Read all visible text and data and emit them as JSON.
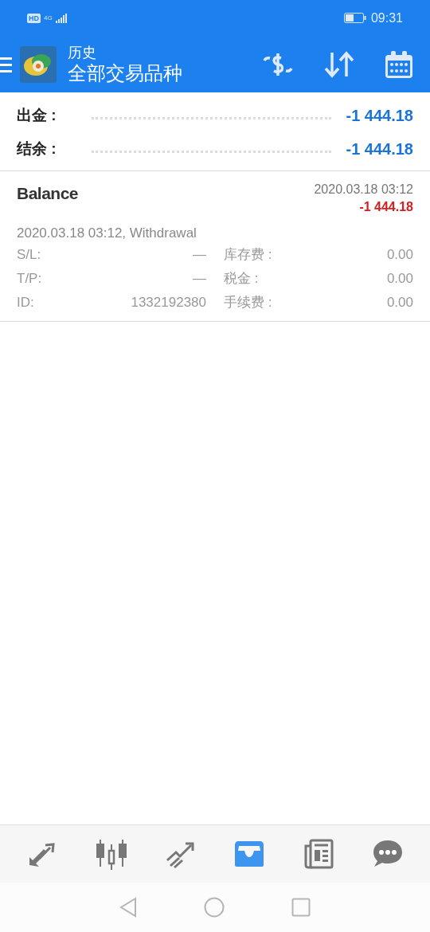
{
  "status_bar": {
    "hd": "HD",
    "network": "4G",
    "time": "09:31"
  },
  "toolbar": {
    "title": "历史",
    "subtitle": "全部交易品种"
  },
  "summary": [
    {
      "label": "出金 :",
      "value": "-1 444.18"
    },
    {
      "label": "结余 :",
      "value": "-1 444.18"
    }
  ],
  "deal": {
    "type": "Balance",
    "time": "2020.03.18 03:12",
    "amount": "-1 444.18",
    "comment": "2020.03.18 03:12, Withdrawal",
    "fields": [
      {
        "label": "S/L:",
        "value": "—",
        "label2": "库存费 :",
        "value2": "0.00"
      },
      {
        "label": "T/P:",
        "value": "—",
        "label2": "税金 :",
        "value2": "0.00"
      },
      {
        "label": "ID:",
        "value": "1332192380",
        "label2": "手续费 :",
        "value2": "0.00"
      }
    ]
  },
  "nav": [
    {
      "kind": "trade",
      "selected": false
    },
    {
      "kind": "chart",
      "selected": false
    },
    {
      "kind": "trend",
      "selected": false
    },
    {
      "kind": "history",
      "selected": true
    },
    {
      "kind": "news",
      "selected": false
    },
    {
      "kind": "chat",
      "selected": false
    }
  ]
}
